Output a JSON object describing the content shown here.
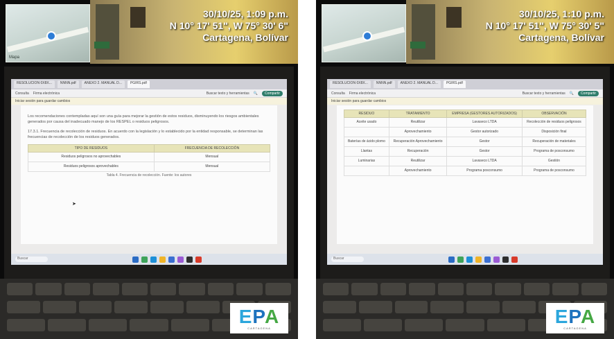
{
  "left_photo": {
    "stamp": {
      "line1": "30/10/25, 1:09 p.m.",
      "line2": "N 10° 17' 51\", W 75° 30' 6\"",
      "line3": "Cartagena, Bolívar"
    },
    "map_tag": "Mapa",
    "tabs": [
      "RESOLUCION 0X8X...",
      "NNNN.pdf",
      "ANEXO 2. MANUAL D...",
      "PGIRS.pdf"
    ],
    "toolbar": {
      "left1": "Consulta",
      "left2": "Firma electrónica",
      "search": "Buscar texto y herramientas",
      "pill": "Compartir"
    },
    "banner": "Iniciar sesión para guardar cambios",
    "para1": "Los recomendaciones contempladas aquí son una guía para mejorar la gestión de estos residuos, disminuyendo los riesgos ambientales generados por causa del inadecuado manejo de los RESPEL o residuos peligrosos.",
    "para2": "17.3.1. Frecuencia de recolección de residuos. En acuerdo con la legislación y lo establecido por la entidad responsable, se determinan las frecuencias de recolección de los residuos generados.",
    "table": {
      "headers": [
        "TIPO DE RESIDUOS",
        "FRECUENCIA DE RECOLECCIÓN"
      ],
      "rows": [
        [
          "Residuos peligrosos no aprovechables",
          "Mensual"
        ],
        [
          "Residuos peligrosos aprovechables",
          "Mensual"
        ]
      ]
    },
    "caption": "Tabla 4. Frecuencia de recolección. Fuente: los autores",
    "taskbar_search": "Buscar",
    "logo": {
      "word": "EPA",
      "sub": "CARTAGENA"
    }
  },
  "right_photo": {
    "stamp": {
      "line1": "30/10/25, 1:10 p.m.",
      "line2": "N 10° 17' 51\", W 75° 30' 5\"",
      "line3": "Cartagena, Bolívar"
    },
    "tabs": [
      "RESOLUCION 0X8X...",
      "NNNN.pdf",
      "ANEXO 2. MANUAL D...",
      "PGIRS.pdf"
    ],
    "toolbar": {
      "left1": "Consulta",
      "left2": "Firma electrónica",
      "search": "Buscar texto y herramientas",
      "pill": "Compartir"
    },
    "banner": "Iniciar sesión para guardar cambios",
    "table": {
      "headers": [
        "Residuo",
        "Tratamiento",
        "Empresa (Gestores autorizados)",
        "Observación"
      ],
      "rows": [
        [
          "Aceite usado",
          "Reutilizar",
          "Lavaseco LTDA",
          "Recolección de residuos peligrosos"
        ],
        [
          "",
          "Aprovechamiento",
          "Gestor autorizado",
          "Disposición final"
        ],
        [
          "Baterías de ácido plomo",
          "Recuperación Aprovechamiento",
          "Gestor",
          "Recuperación de materiales"
        ],
        [
          "Llantas",
          "Recuperación",
          "Gestor",
          "Programa de posconsumo"
        ],
        [
          "Luminarias",
          "Reutilizar",
          "Lavaseco LTDA",
          "Gestión"
        ],
        [
          "",
          "Aprovechamiento",
          "Programa posconsumo",
          "Programa de posconsumo"
        ]
      ]
    },
    "taskbar_search": "Buscar",
    "logo": {
      "word": "EPA",
      "sub": "CARTAGENA"
    }
  },
  "colors": {
    "banner_header": "#e7e4b8",
    "pill": "#2f7d6b",
    "epa_e": "#2ba6dc",
    "epa_p": "#1e73be",
    "epa_a": "#45a844"
  }
}
